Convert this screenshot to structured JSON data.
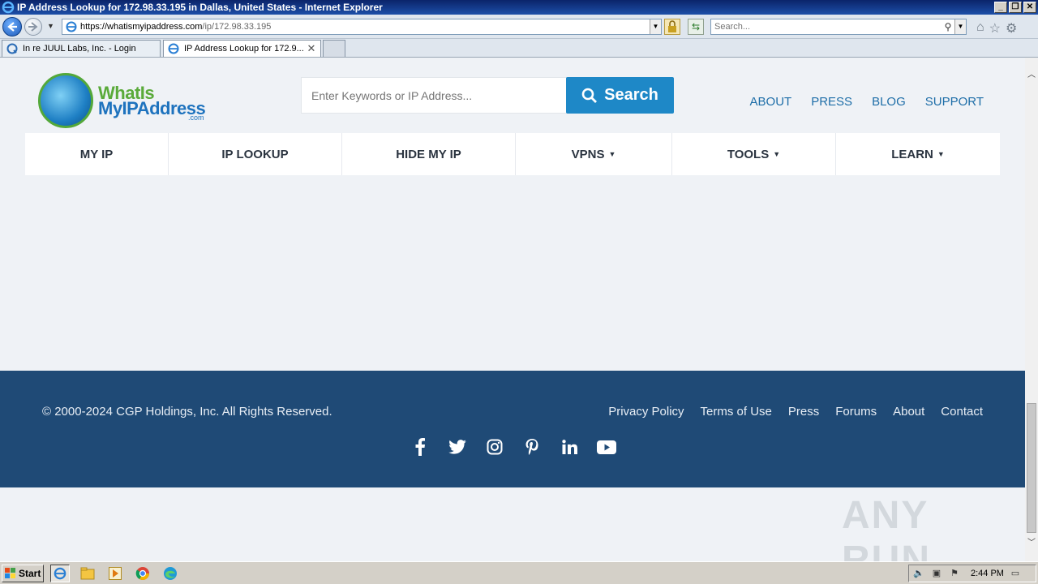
{
  "window": {
    "title": "IP Address Lookup for 172.98.33.195 in Dallas, United States - Internet Explorer",
    "controls": {
      "minimize": "_",
      "restore": "❐",
      "close": "✕"
    }
  },
  "addressbar": {
    "url_host": "https://whatismyipaddress.com",
    "url_path": "/ip/172.98.33.195",
    "search_placeholder": "Search..."
  },
  "tabs": [
    {
      "label": "In re JUUL Labs, Inc. - Login",
      "active": false
    },
    {
      "label": "IP Address Lookup for 172.9...",
      "active": true,
      "close": "✕"
    }
  ],
  "site": {
    "logo": {
      "line1": "WhatIs",
      "line2": "MyIPAddress",
      "line3": ".com"
    },
    "search_placeholder": "Enter Keywords or IP Address...",
    "search_button": "Search",
    "top_links": [
      "ABOUT",
      "PRESS",
      "BLOG",
      "SUPPORT"
    ],
    "nav": [
      {
        "label": "MY IP",
        "caret": ""
      },
      {
        "label": "IP LOOKUP",
        "caret": ""
      },
      {
        "label": "HIDE MY IP",
        "caret": ""
      },
      {
        "label": "VPNS",
        "caret": "▼"
      },
      {
        "label": "TOOLS",
        "caret": "▼"
      },
      {
        "label": "LEARN",
        "caret": "▼"
      }
    ],
    "footer": {
      "copyright": "© 2000-2024 CGP Holdings, Inc. All Rights Reserved.",
      "links": [
        "Privacy Policy",
        "Terms of Use",
        "Press",
        "Forums",
        "About",
        "Contact"
      ],
      "social": [
        "facebook-icon",
        "twitter-icon",
        "instagram-icon",
        "pinterest-icon",
        "linkedin-icon",
        "youtube-icon"
      ]
    }
  },
  "watermark": "ANY RUN",
  "taskbar": {
    "start": "Start",
    "clock": "2:44 PM"
  },
  "colors": {
    "accent": "#1e88c7",
    "footer_bg": "#1f4a76",
    "link": "#1e6ea8"
  }
}
